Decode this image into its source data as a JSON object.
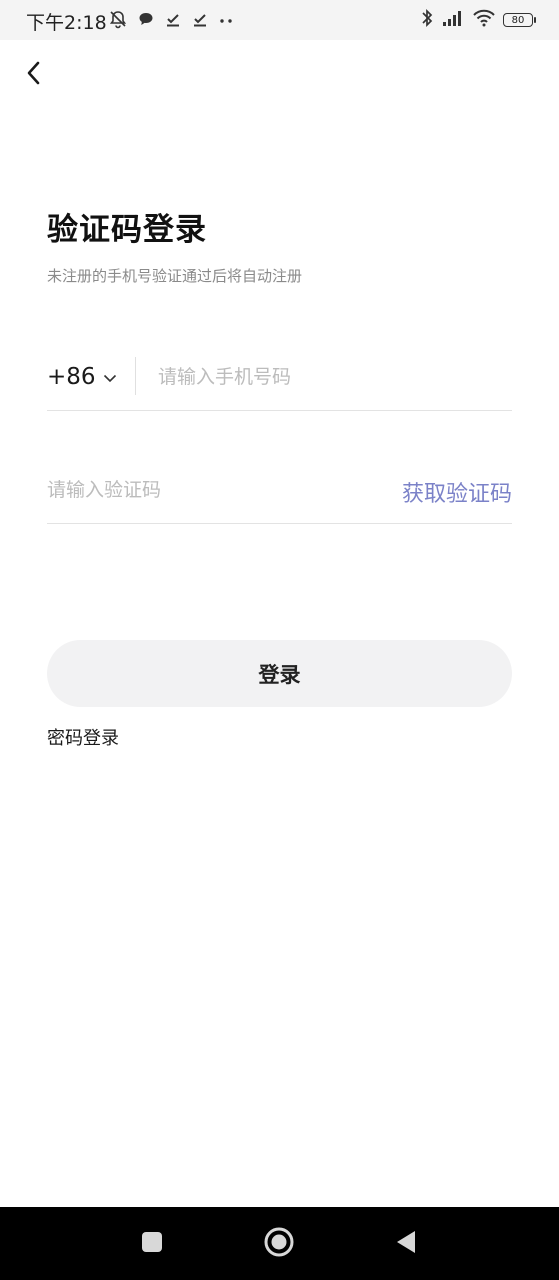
{
  "status_bar": {
    "time": "下午2:18",
    "battery_level": "80",
    "left_icons": [
      "mute-bell-icon",
      "chat-bubble-icon",
      "check-icon",
      "check-icon",
      "more-dots-icon"
    ],
    "right_icons": [
      "bluetooth-icon",
      "signal-icon",
      "wifi-icon",
      "battery-icon"
    ]
  },
  "header": {
    "back_icon": "chevron-left-icon"
  },
  "main": {
    "title": "验证码登录",
    "subtitle": "未注册的手机号验证通过后将自动注册",
    "country_code": "+86",
    "phone_placeholder": "请输入手机号码",
    "phone_value": "",
    "code_placeholder": "请输入验证码",
    "code_value": "",
    "get_code_label": "获取验证码",
    "login_label": "登录",
    "password_login_label": "密码登录"
  },
  "colors": {
    "accent": "#7b82c8",
    "login_button_bg": "#f2f2f3",
    "placeholder": "#bcbcbc",
    "divider": "#e3e3e3",
    "nav_bar": "#000000"
  },
  "nav_bar": {
    "buttons": [
      "recent-apps-icon",
      "home-icon",
      "back-icon"
    ]
  }
}
